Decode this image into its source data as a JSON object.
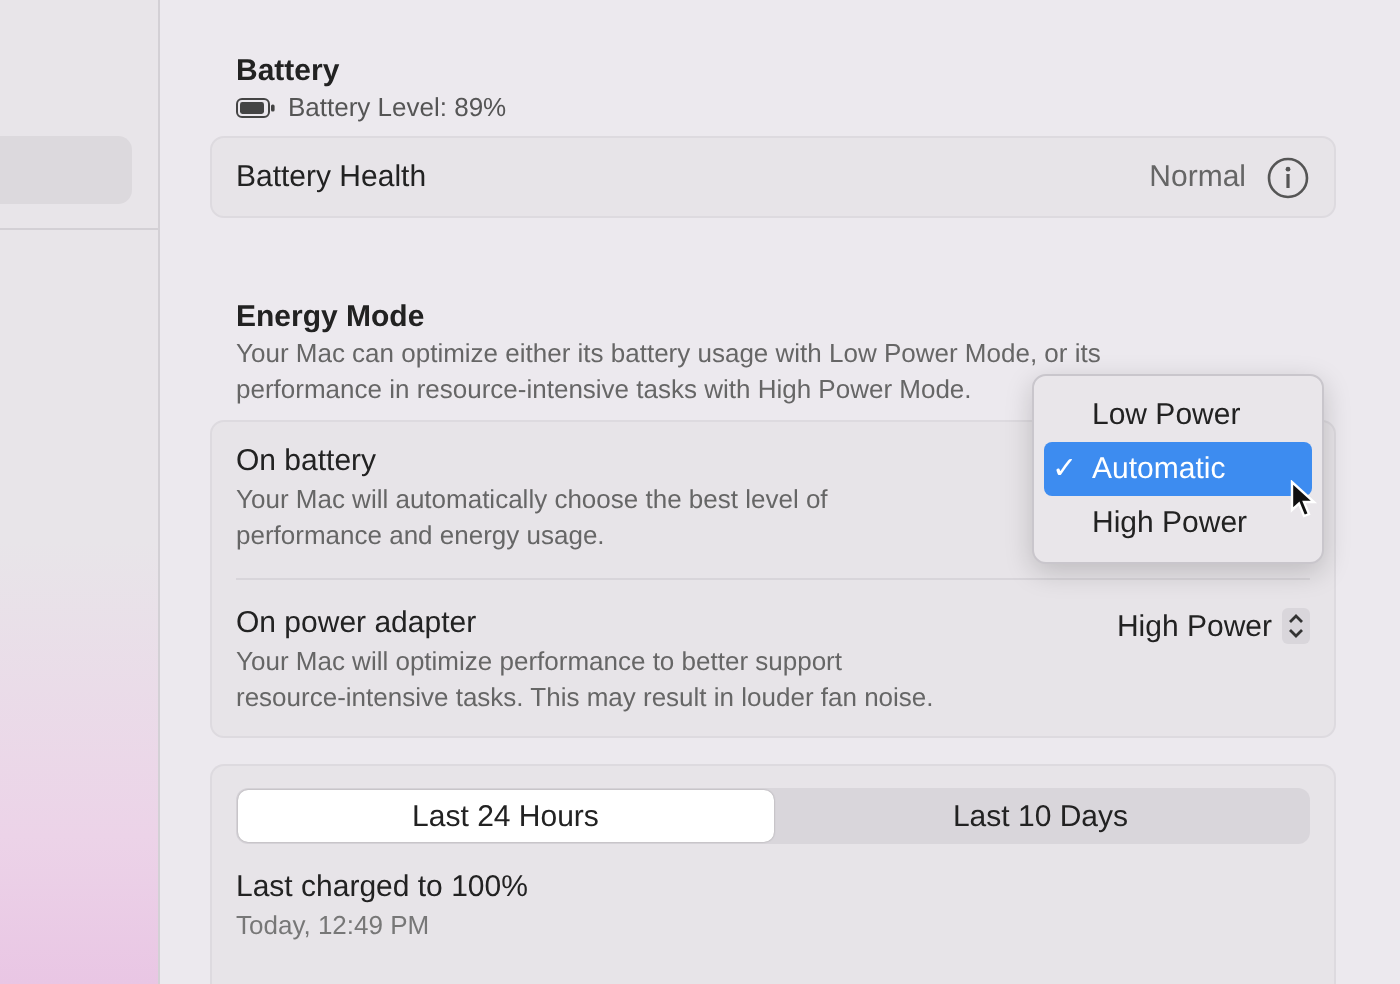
{
  "battery": {
    "title": "Battery",
    "level_text": "Battery Level: 89%"
  },
  "battery_health": {
    "label": "Battery Health",
    "value": "Normal"
  },
  "energy_mode": {
    "title": "Energy Mode",
    "description": "Your Mac can optimize either its battery usage with Low Power Mode, or its performance in resource-intensive tasks with High Power Mode.",
    "rows": [
      {
        "title": "On battery",
        "description": "Your Mac will automatically choose the best level of performance and energy usage.",
        "menu_open": true
      },
      {
        "title": "On power adapter",
        "description": "Your Mac will optimize performance to better support resource-intensive tasks. This may result in louder fan noise.",
        "value": "High Power",
        "menu_open": false
      }
    ]
  },
  "menu": {
    "items": [
      {
        "label": "Low Power",
        "selected": false
      },
      {
        "label": "Automatic",
        "selected": true
      },
      {
        "label": "High Power",
        "selected": false
      }
    ],
    "check": "✓"
  },
  "usage": {
    "tabs": [
      {
        "label": "Last 24 Hours",
        "selected": true
      },
      {
        "label": "Last 10 Days",
        "selected": false
      }
    ],
    "last_charged": "Last charged to 100%",
    "time": "Today, 12:49 PM"
  }
}
